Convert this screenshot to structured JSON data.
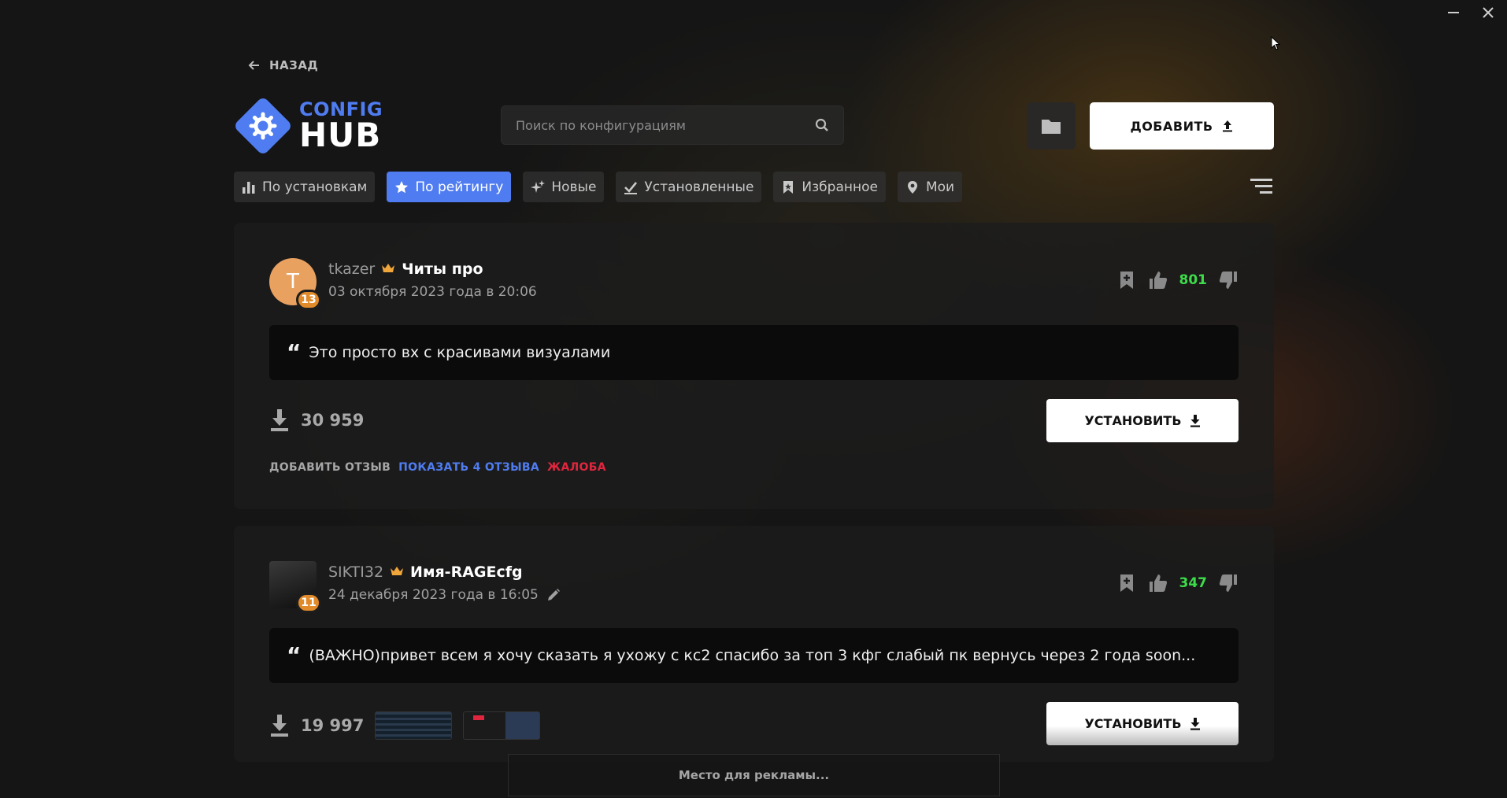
{
  "header": {
    "back_label": "НАЗАД",
    "logo_top": "CONFIG",
    "logo_bottom": "HUB",
    "search_placeholder": "Поиск по конфигурациям",
    "add_label": "ДОБАВИТЬ"
  },
  "tabs": [
    {
      "label": "По установкам",
      "icon": "bar-chart-icon",
      "active": false
    },
    {
      "label": "По рейтингу",
      "icon": "star-icon",
      "active": true
    },
    {
      "label": "Новые",
      "icon": "sparkle-icon",
      "active": false
    },
    {
      "label": "Установленные",
      "icon": "check-icon",
      "active": false
    },
    {
      "label": "Избранное",
      "icon": "bookmark-icon",
      "active": false
    },
    {
      "label": "Мои",
      "icon": "location-pin-icon",
      "active": false
    }
  ],
  "configs": [
    {
      "avatar_letter": "T",
      "level": "13",
      "username": "tkazer",
      "title": "Читы про",
      "date": "03 октября 2023 года в 20:06",
      "score": "801",
      "description": "Это просто вх с красивами визуалами",
      "downloads": "30 959",
      "install_label": "УСТАНОВИТЬ",
      "add_review": "ДОБАВИТЬ ОТЗЫВ",
      "show_reviews": "ПОКАЗАТЬ 4 ОТЗЫВА",
      "complaint": "ЖАЛОБА"
    },
    {
      "level": "11",
      "username": "SIKTI32",
      "title": "Имя-RAGEcfg",
      "date": "24 декабря 2023 года в 16:05",
      "score": "347",
      "description": "(ВАЖНО)привет всем я хочу сказать я ухожу с кс2 спасибо за топ 3 кфг слабый пк вернусь через 2 года soon...",
      "downloads": "19 997",
      "install_label": "УСТАНОВИТЬ"
    }
  ],
  "ad_text": "Место для рекламы...",
  "colors": {
    "accent": "#4f7cf0",
    "score": "#3ddc4a",
    "danger": "#e2253e",
    "badge": "#e08a2a"
  }
}
